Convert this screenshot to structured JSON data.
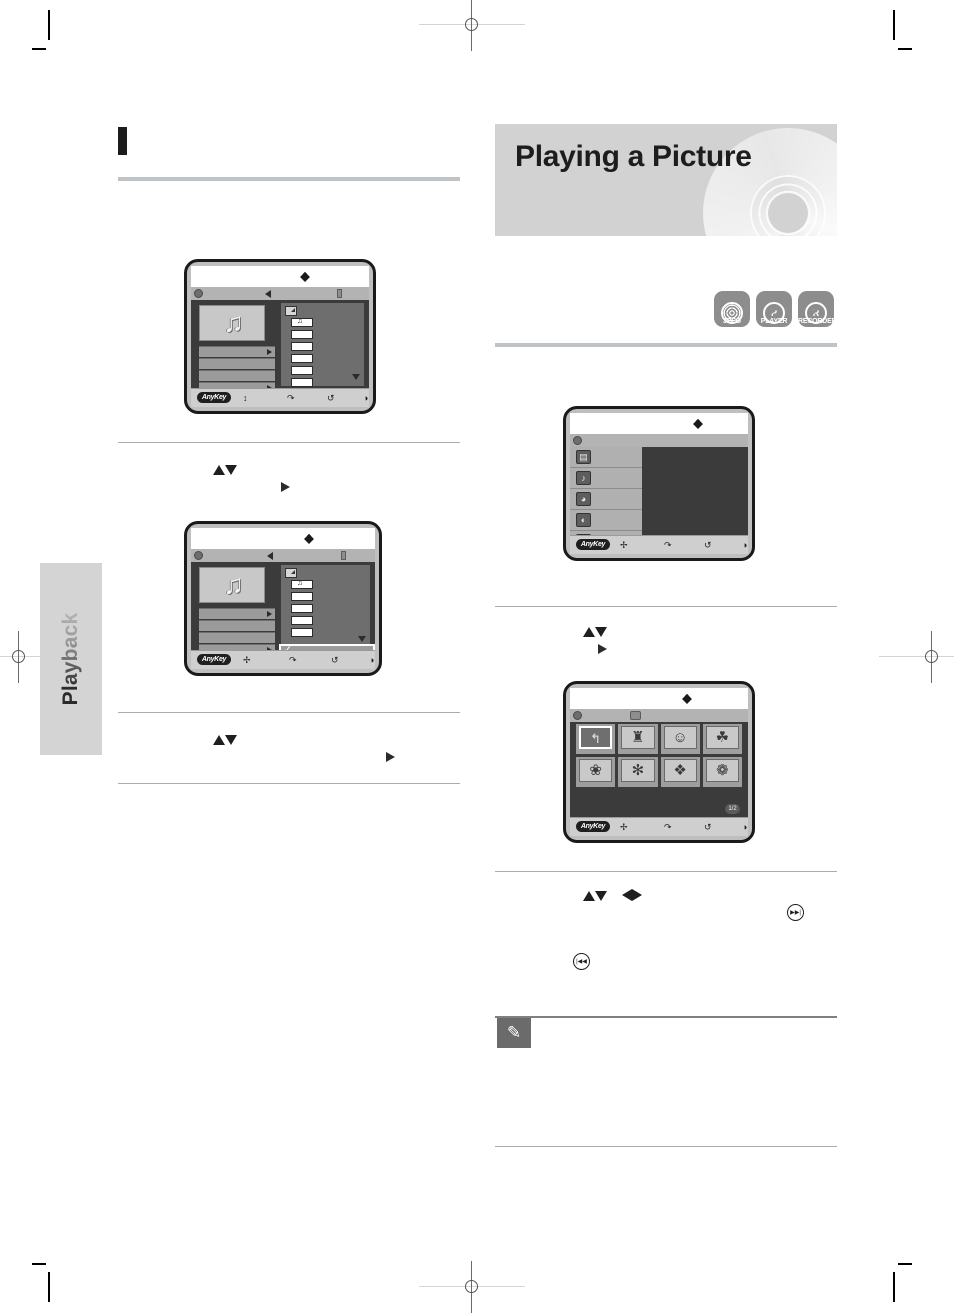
{
  "page": {
    "chapter_tab_label": "Playback",
    "heading": "Playing a Picture"
  },
  "disc_badges": [
    {
      "name": "jpeg-badge",
      "caption": "JPEG",
      "glyph": "rings"
    },
    {
      "name": "player-badge",
      "caption": "PLAYER",
      "glyph": "P"
    },
    {
      "name": "recorder-badge",
      "caption": "RECORDER",
      "glyph": "R"
    }
  ],
  "screens": {
    "left_music_menu": {
      "title": "",
      "bottom_bar": {
        "anykey_label": "AnyKey",
        "icons": [
          "updown-icon",
          "return-icon",
          "repeat-icon",
          "info-icon"
        ]
      },
      "thumbnail": "music-note",
      "list_rows": [
        "",
        "",
        "",
        ""
      ],
      "file_items": [
        "music-file",
        "",
        "",
        "",
        "",
        ""
      ]
    },
    "left_music_menu_selected": {
      "title": "",
      "bottom_bar": {
        "anykey_label": "AnyKey",
        "icons": [
          "move-icon",
          "return-icon",
          "repeat-icon",
          "info-icon"
        ]
      },
      "thumbnail": "music-note",
      "list_rows": [
        "",
        "",
        "",
        ""
      ],
      "selected_mark": "✓"
    },
    "right_main_menu": {
      "title": "",
      "items": [
        {
          "name": "menu-item-title",
          "icon": "film-icon"
        },
        {
          "name": "menu-item-music",
          "icon": "music-icon"
        },
        {
          "name": "menu-item-photo",
          "icon": "photo-icon"
        },
        {
          "name": "menu-item-disc",
          "icon": "disc-icon"
        },
        {
          "name": "menu-item-setup",
          "icon": "setup-icon"
        }
      ],
      "bottom_bar": {
        "anykey_label": "AnyKey",
        "icons": [
          "move-icon",
          "return-icon",
          "repeat-icon",
          "info-icon"
        ]
      }
    },
    "right_photo_grid": {
      "title": "",
      "page_badge": "1/2",
      "cells": [
        {
          "name": "photo-cell-parent-folder",
          "glyph": "↰",
          "selected": true
        },
        {
          "name": "photo-cell-castle",
          "glyph": "♜",
          "selected": false
        },
        {
          "name": "photo-cell-person",
          "glyph": "☺",
          "selected": false
        },
        {
          "name": "photo-cell-tree",
          "glyph": "☘",
          "selected": false
        },
        {
          "name": "photo-cell-flower",
          "glyph": "❀",
          "selected": false
        },
        {
          "name": "photo-cell-sun",
          "glyph": "✻",
          "selected": false
        },
        {
          "name": "photo-cell-object",
          "glyph": "❖",
          "selected": false
        },
        {
          "name": "photo-cell-bouquet",
          "glyph": "❁",
          "selected": false
        }
      ],
      "bottom_bar": {
        "anykey_label": "AnyKey",
        "icons": [
          "move-icon",
          "return-icon",
          "repeat-icon",
          "info-icon"
        ]
      }
    }
  },
  "step_glyphs": {
    "updown": "▲▼",
    "right": "▶",
    "four_way": "▲▼ ◀▶",
    "skip_next": "▶▶|",
    "skip_prev": "|◀◀"
  },
  "note": {
    "icon": "pencil-icon"
  }
}
